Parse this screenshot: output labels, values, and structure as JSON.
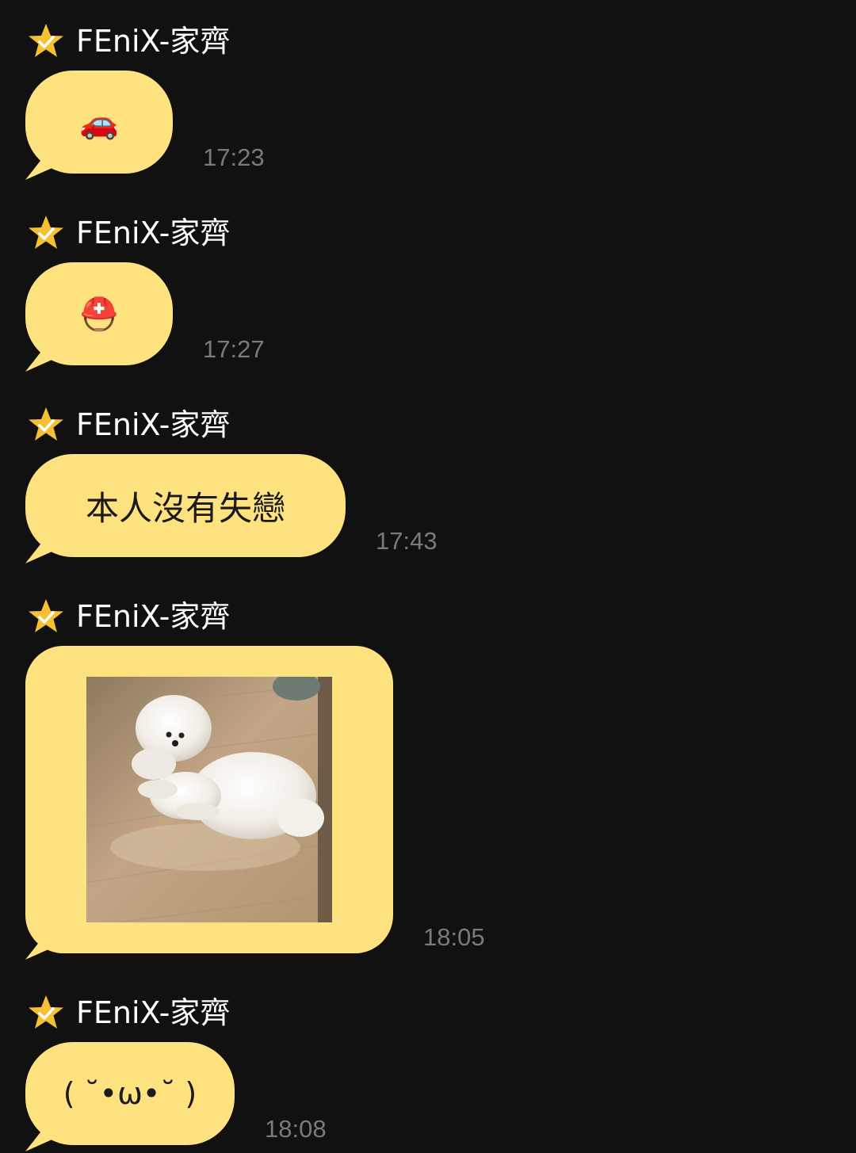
{
  "messages": [
    {
      "sender": "FEniX-家齊",
      "content_type": "emoji",
      "content": "🚗",
      "time": "17:23"
    },
    {
      "sender": "FEniX-家齊",
      "content_type": "emoji",
      "content": "⛑️",
      "time": "17:27"
    },
    {
      "sender": "FEniX-家齊",
      "content_type": "text",
      "content": "本人沒有失戀",
      "time": "17:43"
    },
    {
      "sender": "FEniX-家齊",
      "content_type": "image",
      "content": "white-dog-photo",
      "time": "18:05"
    },
    {
      "sender": "FEniX-家齊",
      "content_type": "text",
      "content": "( ˘•ω•˘ )",
      "time": "18:08"
    }
  ],
  "colors": {
    "background": "#111111",
    "bubble": "#fde27f",
    "sender_text": "#ffffff",
    "time_text": "#7a7a7a",
    "star": "#f6c033"
  },
  "icons": {
    "sender_badge": "star-check-icon"
  }
}
